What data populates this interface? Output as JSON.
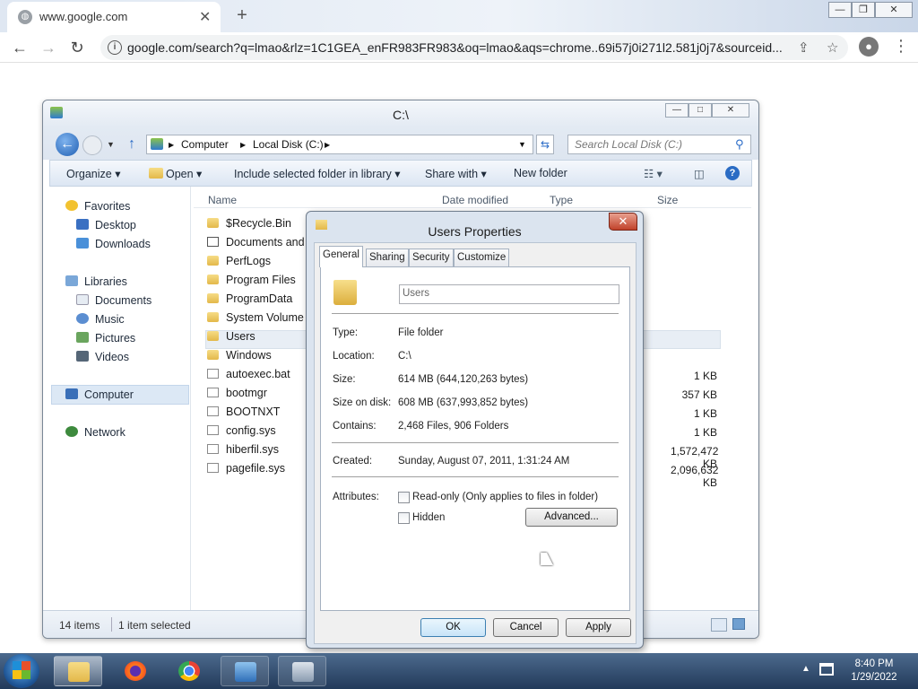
{
  "browser": {
    "tab_title": "www.google.com",
    "tab_close": "✕",
    "new_tab": "+",
    "url": "google.com/search?q=lmao&rlz=1C1GEA_enFR983FR983&oq=lmao&aqs=chrome..69i57j0i271l2.581j0j7&sourceid...",
    "win_minimize": "—",
    "win_restore": "❐",
    "win_close": "✕",
    "nav_back": "←",
    "nav_forward": "→",
    "nav_reload": "↻",
    "share": "⇪",
    "star": "☆",
    "menu": "⋮",
    "account": "●",
    "info": "i"
  },
  "explorer": {
    "title": "C:\\",
    "breadcrumb": [
      "Computer",
      "Local Disk (C:)"
    ],
    "search_placeholder": "Search Local Disk (C:)",
    "commands": {
      "organize": "Organize ▾",
      "open": "Open ▾",
      "include": "Include selected folder in library ▾",
      "share": "Share with ▾",
      "new_folder": "New folder"
    },
    "nav": {
      "favorites": "Favorites",
      "desktop": "Desktop",
      "downloads": "Downloads",
      "libraries": "Libraries",
      "documents": "Documents",
      "music": "Music",
      "pictures": "Pictures",
      "videos": "Videos",
      "computer": "Computer",
      "network": "Network"
    },
    "columns": {
      "name": "Name",
      "date": "Date modified",
      "type": "Type",
      "size": "Size"
    },
    "files": [
      {
        "name": "$Recycle.Bin",
        "size": ""
      },
      {
        "name": "Documents and",
        "size": ""
      },
      {
        "name": "PerfLogs",
        "size": ""
      },
      {
        "name": "Program Files",
        "size": ""
      },
      {
        "name": "ProgramData",
        "size": ""
      },
      {
        "name": "System Volume I",
        "size": ""
      },
      {
        "name": "Users",
        "size": ""
      },
      {
        "name": "Windows",
        "size": ""
      },
      {
        "name": "autoexec.bat",
        "size": "1 KB"
      },
      {
        "name": "bootmgr",
        "size": "357 KB"
      },
      {
        "name": "BOOTNXT",
        "size": "1 KB"
      },
      {
        "name": "config.sys",
        "size": "1 KB"
      },
      {
        "name": "hiberfil.sys",
        "size": "1,572,472 KB"
      },
      {
        "name": "pagefile.sys",
        "size": "2,096,632 KB"
      }
    ],
    "status": {
      "count": "14 items",
      "selected": "1 item selected"
    }
  },
  "dialog": {
    "title": "Users Properties",
    "close": "✕",
    "tabs": [
      "General",
      "Sharing",
      "Security",
      "Customize"
    ],
    "name_value": "Users",
    "props": {
      "type_label": "Type:",
      "type_value": "File folder",
      "location_label": "Location:",
      "location_value": "C:\\",
      "size_label": "Size:",
      "size_value": "614 MB (644,120,263 bytes)",
      "sizeondisk_label": "Size on disk:",
      "sizeondisk_value": "608 MB (637,993,852 bytes)",
      "contains_label": "Contains:",
      "contains_value": "2,468 Files, 906 Folders",
      "created_label": "Created:",
      "created_value": "Sunday, August 07, 2011, 1:31:24 AM",
      "attributes_label": "Attributes:",
      "readonly_label": "Read-only (Only applies to files in folder)",
      "hidden_label": "Hidden",
      "advanced_button": "Advanced..."
    },
    "buttons": {
      "ok": "OK",
      "cancel": "Cancel",
      "apply": "Apply"
    }
  },
  "taskbar": {
    "time": "8:40 PM",
    "date": "1/29/2022",
    "tray": "▲"
  }
}
